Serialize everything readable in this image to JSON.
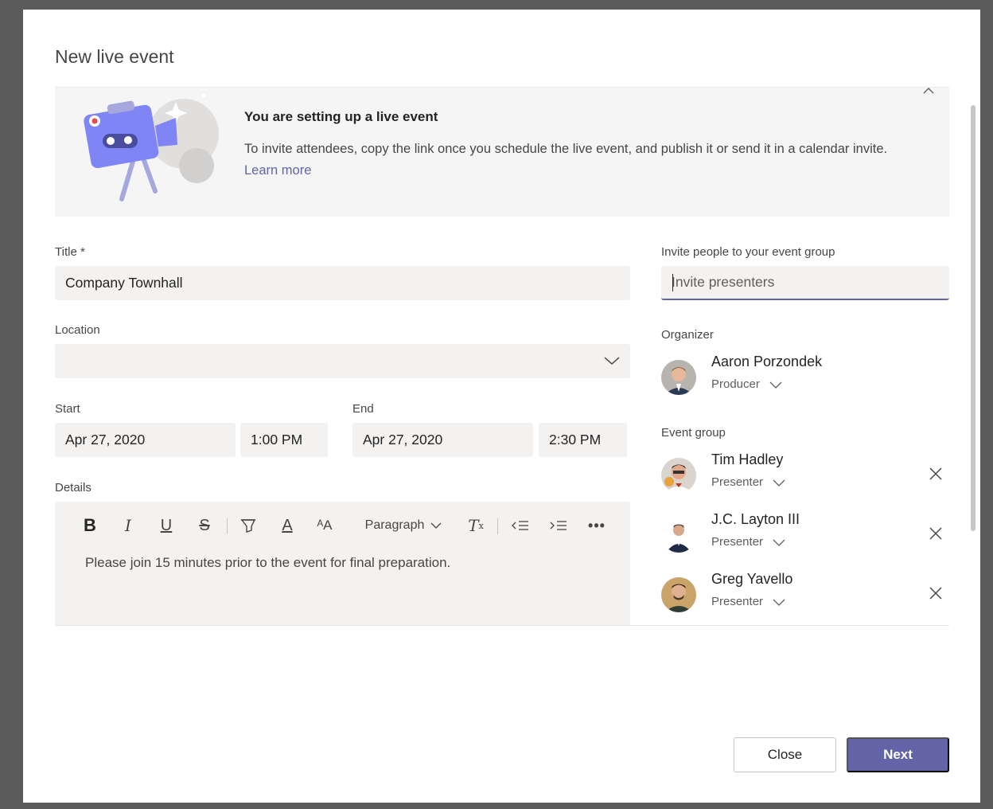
{
  "dialog": {
    "title": "New live event"
  },
  "banner": {
    "title": "You are setting up a live event",
    "text": "To invite attendees, copy the link once you schedule the live event, and publish it or send it in a calendar invite.",
    "link": "Learn more"
  },
  "form": {
    "title_label": "Title *",
    "title_value": "Company Townhall",
    "location_label": "Location",
    "location_value": "",
    "start_label": "Start",
    "start_date": "Apr 27, 2020",
    "start_time": "1:00 PM",
    "end_label": "End",
    "end_date": "Apr 27, 2020",
    "end_time": "2:30 PM",
    "details_label": "Details",
    "paragraph_label": "Paragraph",
    "details_text": "Please join 15 minutes prior to the event for final preparation."
  },
  "invite": {
    "label": "Invite people to your event group",
    "placeholder": "Invite presenters"
  },
  "organizer": {
    "label": "Organizer",
    "name": "Aaron Porzondek",
    "role": "Producer"
  },
  "event_group": {
    "label": "Event group",
    "members": [
      {
        "name": "Tim Hadley",
        "role": "Presenter"
      },
      {
        "name": "J.C. Layton III",
        "role": "Presenter"
      },
      {
        "name": "Greg Yavello",
        "role": "Presenter"
      }
    ]
  },
  "footer": {
    "close_label": "Close",
    "next_label": "Next"
  },
  "colors": {
    "accent": "#6264a7",
    "field_bg": "#f3f2f1"
  }
}
